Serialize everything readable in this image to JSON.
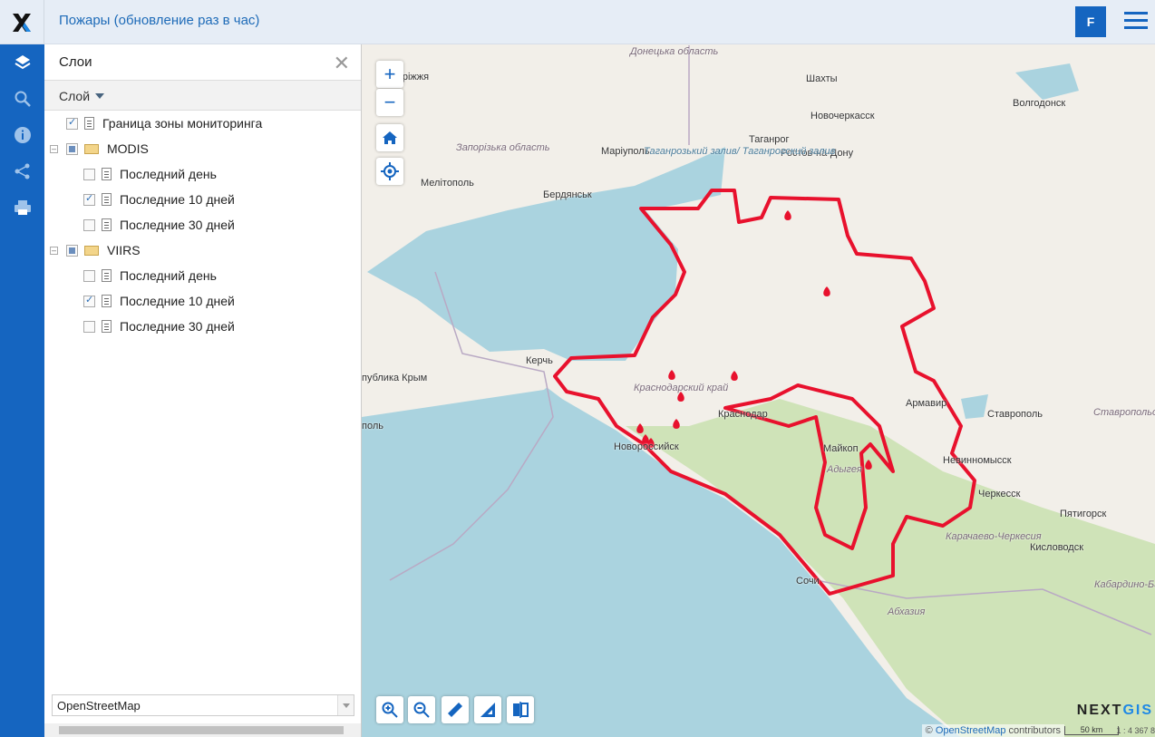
{
  "header": {
    "title": "Пожары (обновление раз в час)",
    "user_initial": "F"
  },
  "rail": {
    "icons": [
      "layers-icon",
      "search-icon",
      "info-icon",
      "share-icon",
      "print-icon"
    ]
  },
  "panel": {
    "title": "Слои",
    "column_header": "Слой",
    "layers": [
      {
        "label": "Граница зоны мониторинга",
        "checked": true
      },
      {
        "label": "MODIS",
        "group": true,
        "children": [
          {
            "label": "Последний день",
            "checked": false
          },
          {
            "label": "Последние 10 дней",
            "checked": true
          },
          {
            "label": "Последние 30 дней",
            "checked": false
          }
        ]
      },
      {
        "label": "VIIRS",
        "group": true,
        "children": [
          {
            "label": "Последний день",
            "checked": false
          },
          {
            "label": "Последние 10 дней",
            "checked": true
          },
          {
            "label": "Последние 30 дней",
            "checked": false
          }
        ]
      }
    ],
    "basemap": "OpenStreetMap"
  },
  "map": {
    "labels": [
      "Донецька область",
      "Запоріжжя",
      "Шахты",
      "Новочеркасск",
      "Волгодонск",
      "Таганрог",
      "Ростов-на-Дону",
      "Маріуполь",
      "Таганрозький залив/ Таганрогский залив",
      "Запорізька область",
      "Мелітополь",
      "Бердянськ",
      "Керчь",
      "Краснодарский край",
      "Краснодар",
      "Армавир",
      "Ставрополь",
      "Ставропольский край",
      "Новороссийск",
      "Майкоп",
      "Адыгея",
      "Невинномысск",
      "Черкесск",
      "Пятигорск",
      "Кисловодск",
      "Карачаево-Черкесия",
      "Сочи",
      "Кабардино-Балкария",
      "Абхазия",
      "публика Крым",
      "поль"
    ],
    "attribution_prefix": "© ",
    "attribution_link": "OpenStreetMap",
    "attribution_suffix": " contributors",
    "scale": "50 km",
    "ratio": "1 : 4 367 8",
    "brand": "NEXTGIS",
    "boundary_color": "#e8112d",
    "water_color": "#aad3df",
    "land_color": "#f2efe9"
  },
  "map_controls": [
    "zoom-in",
    "zoom-out",
    "home",
    "locate"
  ],
  "toolbar": [
    "zoom-in-tool",
    "zoom-out-tool",
    "measure-distance",
    "measure-area",
    "swipe"
  ]
}
